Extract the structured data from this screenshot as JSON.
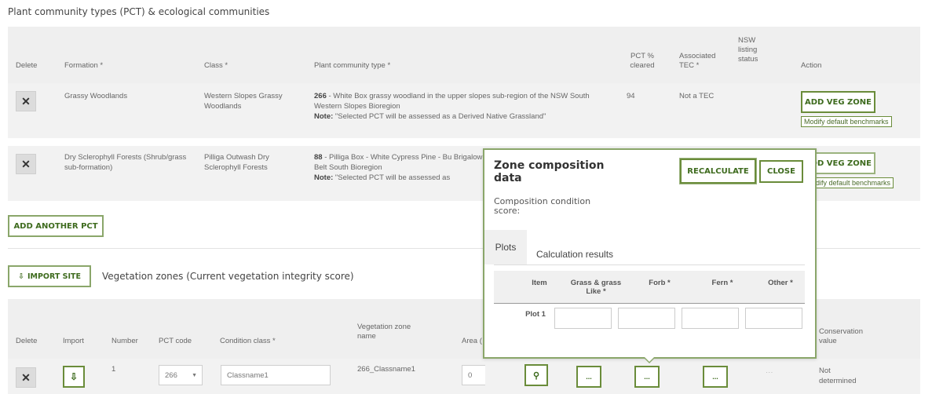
{
  "section_title": "Plant community types (PCT) & ecological communities",
  "pct_table": {
    "headers": {
      "delete": "Delete",
      "formation": "Formation *",
      "class": "Class *",
      "pct": "Plant community type *",
      "cleared": "PCT % cleared",
      "tec": "Associated TEC *",
      "nsw": "NSW listing status",
      "action": "Action"
    },
    "rows": [
      {
        "delete": "✕",
        "formation": "Grassy Woodlands",
        "class": "Western Slopes Grassy Woodlands",
        "pct_id": "266",
        "pct_desc": " - White Box grassy woodland in the upper slopes sub-region of the NSW South Western Slopes Bioregion",
        "note_label": "Note:",
        "note": " \"Selected PCT will be assessed as a Derived Native Grassland\"",
        "cleared": "94",
        "tec": "Not a TEC",
        "action_btn": "ADD VEG ZONE",
        "action_link": "Modify default benchmarks"
      },
      {
        "delete": "✕",
        "formation": "Dry Sclerophyll Forests (Shrub/grass sub-formation)",
        "class": "Pilliga Outwash Dry Sclerophyll Forests",
        "pct_id": "88",
        "pct_desc": " - Pilliga Box - White Cypress Pine - Bu Brigalow Belt South Bioregion",
        "note_label": "Note:",
        "note": " \"Selected PCT will be assessed as",
        "action_btn": "ADD VEG ZONE",
        "action_link": "odify default benchmarks"
      }
    ],
    "add_another": "ADD ANOTHER PCT"
  },
  "veg_zones": {
    "import_btn": "IMPORT SITE",
    "title": "Vegetation zones (Current vegetation integrity score)",
    "headers": {
      "delete": "Delete",
      "import": "Import",
      "number": "Number",
      "pct_code": "PCT code",
      "condition": "Condition class *",
      "zone_name": "Vegetation zone name",
      "area": "Area (",
      "conservation": "Conservation value"
    },
    "row": {
      "delete": "✕",
      "number": "1",
      "pct_code": "266",
      "condition": "Classname1",
      "zone_name": "266_Classname1",
      "area": "0",
      "dots": "...",
      "dash": "···",
      "conservation": "Not determined"
    }
  },
  "popup": {
    "title": "Zone composition data",
    "recalculate": "RECALCULATE",
    "close": "CLOSE",
    "subtitle": "Composition condition score:",
    "tabs": [
      "Plots",
      "Calculation results"
    ],
    "table_headers": [
      "Item",
      "Grass & grass Like *",
      "Forb *",
      "Fern *",
      "Other *"
    ],
    "rows": [
      {
        "item": "Plot 1"
      }
    ]
  },
  "colors": {
    "accent": "#6a8c3a",
    "header_bg": "#efefef",
    "row_bg": "#f2f2f2"
  }
}
